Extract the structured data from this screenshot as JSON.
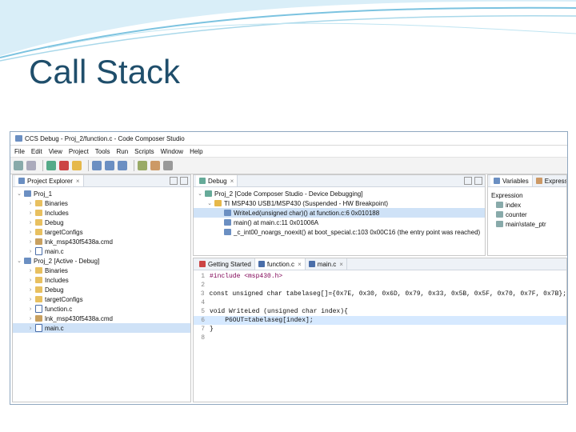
{
  "slide": {
    "title": "Call Stack"
  },
  "window": {
    "title": "CCS Debug - Proj_2/function.c - Code Composer Studio"
  },
  "menu": [
    "File",
    "Edit",
    "View",
    "Project",
    "Tools",
    "Run",
    "Scripts",
    "Window",
    "Help"
  ],
  "project_explorer": {
    "tab": "Project Explorer",
    "items": [
      {
        "label": "Proj_1",
        "level": 0,
        "type": "project",
        "expanded": true
      },
      {
        "label": "Binaries",
        "level": 1,
        "type": "folder"
      },
      {
        "label": "Includes",
        "level": 1,
        "type": "folder"
      },
      {
        "label": "Debug",
        "level": 1,
        "type": "folder"
      },
      {
        "label": "targetConfigs",
        "level": 1,
        "type": "folder"
      },
      {
        "label": "lnk_msp430f5438a.cmd",
        "level": 1,
        "type": "cmd"
      },
      {
        "label": "main.c",
        "level": 1,
        "type": "cfile"
      },
      {
        "label": "Proj_2 [Active - Debug]",
        "level": 0,
        "type": "project",
        "expanded": true
      },
      {
        "label": "Binaries",
        "level": 1,
        "type": "folder"
      },
      {
        "label": "Includes",
        "level": 1,
        "type": "folder"
      },
      {
        "label": "Debug",
        "level": 1,
        "type": "folder"
      },
      {
        "label": "targetConfigs",
        "level": 1,
        "type": "folder"
      },
      {
        "label": "function.c",
        "level": 1,
        "type": "cfile"
      },
      {
        "label": "lnk_msp430f5438a.cmd",
        "level": 1,
        "type": "cmd"
      },
      {
        "label": "main.c",
        "level": 1,
        "type": "cfile",
        "selected": true
      }
    ]
  },
  "debug": {
    "tab": "Debug",
    "items": [
      {
        "label": "Proj_2 [Code Composer Studio - Device Debugging]",
        "level": 0
      },
      {
        "label": "TI MSP430 USB1/MSP430 (Suspended - HW Breakpoint)",
        "level": 1
      },
      {
        "label": "WriteLed(unsigned char)() at function.c:6 0x010188",
        "level": 2,
        "selected": true
      },
      {
        "label": "main() at main.c:11 0x01006A",
        "level": 2
      },
      {
        "label": "_c_int00_noargs_noexit() at boot_special.c:103 0x00C16 (the entry point was reached)",
        "level": 2
      }
    ]
  },
  "variables": {
    "tabs": [
      "Variables",
      "Expressions"
    ],
    "header": "Expression",
    "items": [
      "index",
      "counter",
      "main\\state_ptr"
    ]
  },
  "editor": {
    "tabs": [
      "Getting Started",
      "function.c",
      "main.c"
    ],
    "lines": [
      {
        "n": "1",
        "text": "#include <msp430.h>"
      },
      {
        "n": "2",
        "text": ""
      },
      {
        "n": "3",
        "text": "const unsigned char tabelaseg[]={0x7E, 0x30, 0x6D, 0x79, 0x33, 0x5B, 0x5F, 0x70, 0x7F, 0x7B};"
      },
      {
        "n": "4",
        "text": ""
      },
      {
        "n": "5",
        "text": "void WriteLed (unsigned char index){"
      },
      {
        "n": "6",
        "text": "    P6OUT=tabelaseg[index];"
      },
      {
        "n": "7",
        "text": "}"
      },
      {
        "n": "8",
        "text": ""
      }
    ]
  },
  "colors": {
    "accent": "#1f4e6b",
    "selection": "#cfe2f7"
  }
}
